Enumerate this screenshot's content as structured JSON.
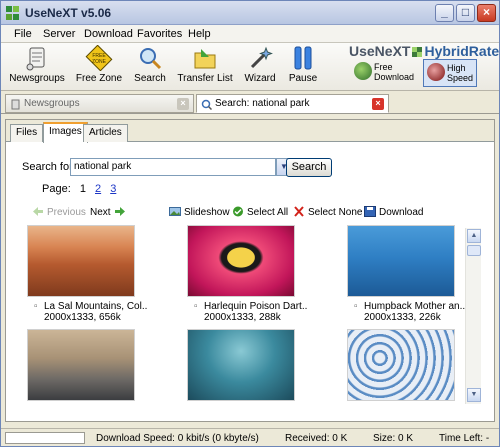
{
  "window": {
    "title": "UseNeXT v5.06"
  },
  "menu": [
    "File",
    "Server",
    "Download",
    "Favorites",
    "Help"
  ],
  "toolbar": {
    "newsgroups": "Newsgroups",
    "free_zone": "Free Zone",
    "search": "Search",
    "transfer_list": "Transfer List",
    "wizard": "Wizard",
    "pause": "Pause"
  },
  "hybrid": {
    "brand": "UseNeXT",
    "brand_hr": "HybridRate",
    "free_line1": "Free",
    "free_line2": "Download",
    "high_line1": "High",
    "high_line2": "Speed"
  },
  "doc_tabs": {
    "newsgroups": "Newsgroups",
    "search": "Search: national park"
  },
  "inner_tabs": {
    "files": "Files",
    "images": "Images",
    "articles": "Articles"
  },
  "search": {
    "label": "Search for:",
    "value": "national park",
    "button": "Search"
  },
  "pager": {
    "label": "Page:",
    "current": "1",
    "p2": "2",
    "p3": "3"
  },
  "actions": {
    "previous": "Previous",
    "next": "Next",
    "slideshow": "Slideshow",
    "select_all": "Select All",
    "select_none": "Select None",
    "download": "Download"
  },
  "results": [
    {
      "name": "La Sal Mountains, Col..",
      "meta": "2000x1333, 656k"
    },
    {
      "name": "Harlequin Poison Dart..",
      "meta": "2000x1333, 288k"
    },
    {
      "name": "Humpback Mother an..",
      "meta": "2000x1333, 226k"
    }
  ],
  "status": {
    "download_speed": "Download Speed: 0 kbit/s (0 kbyte/s)",
    "received": "Received: 0 K",
    "size": "Size: 0 K",
    "time_left": "Time Left: -"
  }
}
